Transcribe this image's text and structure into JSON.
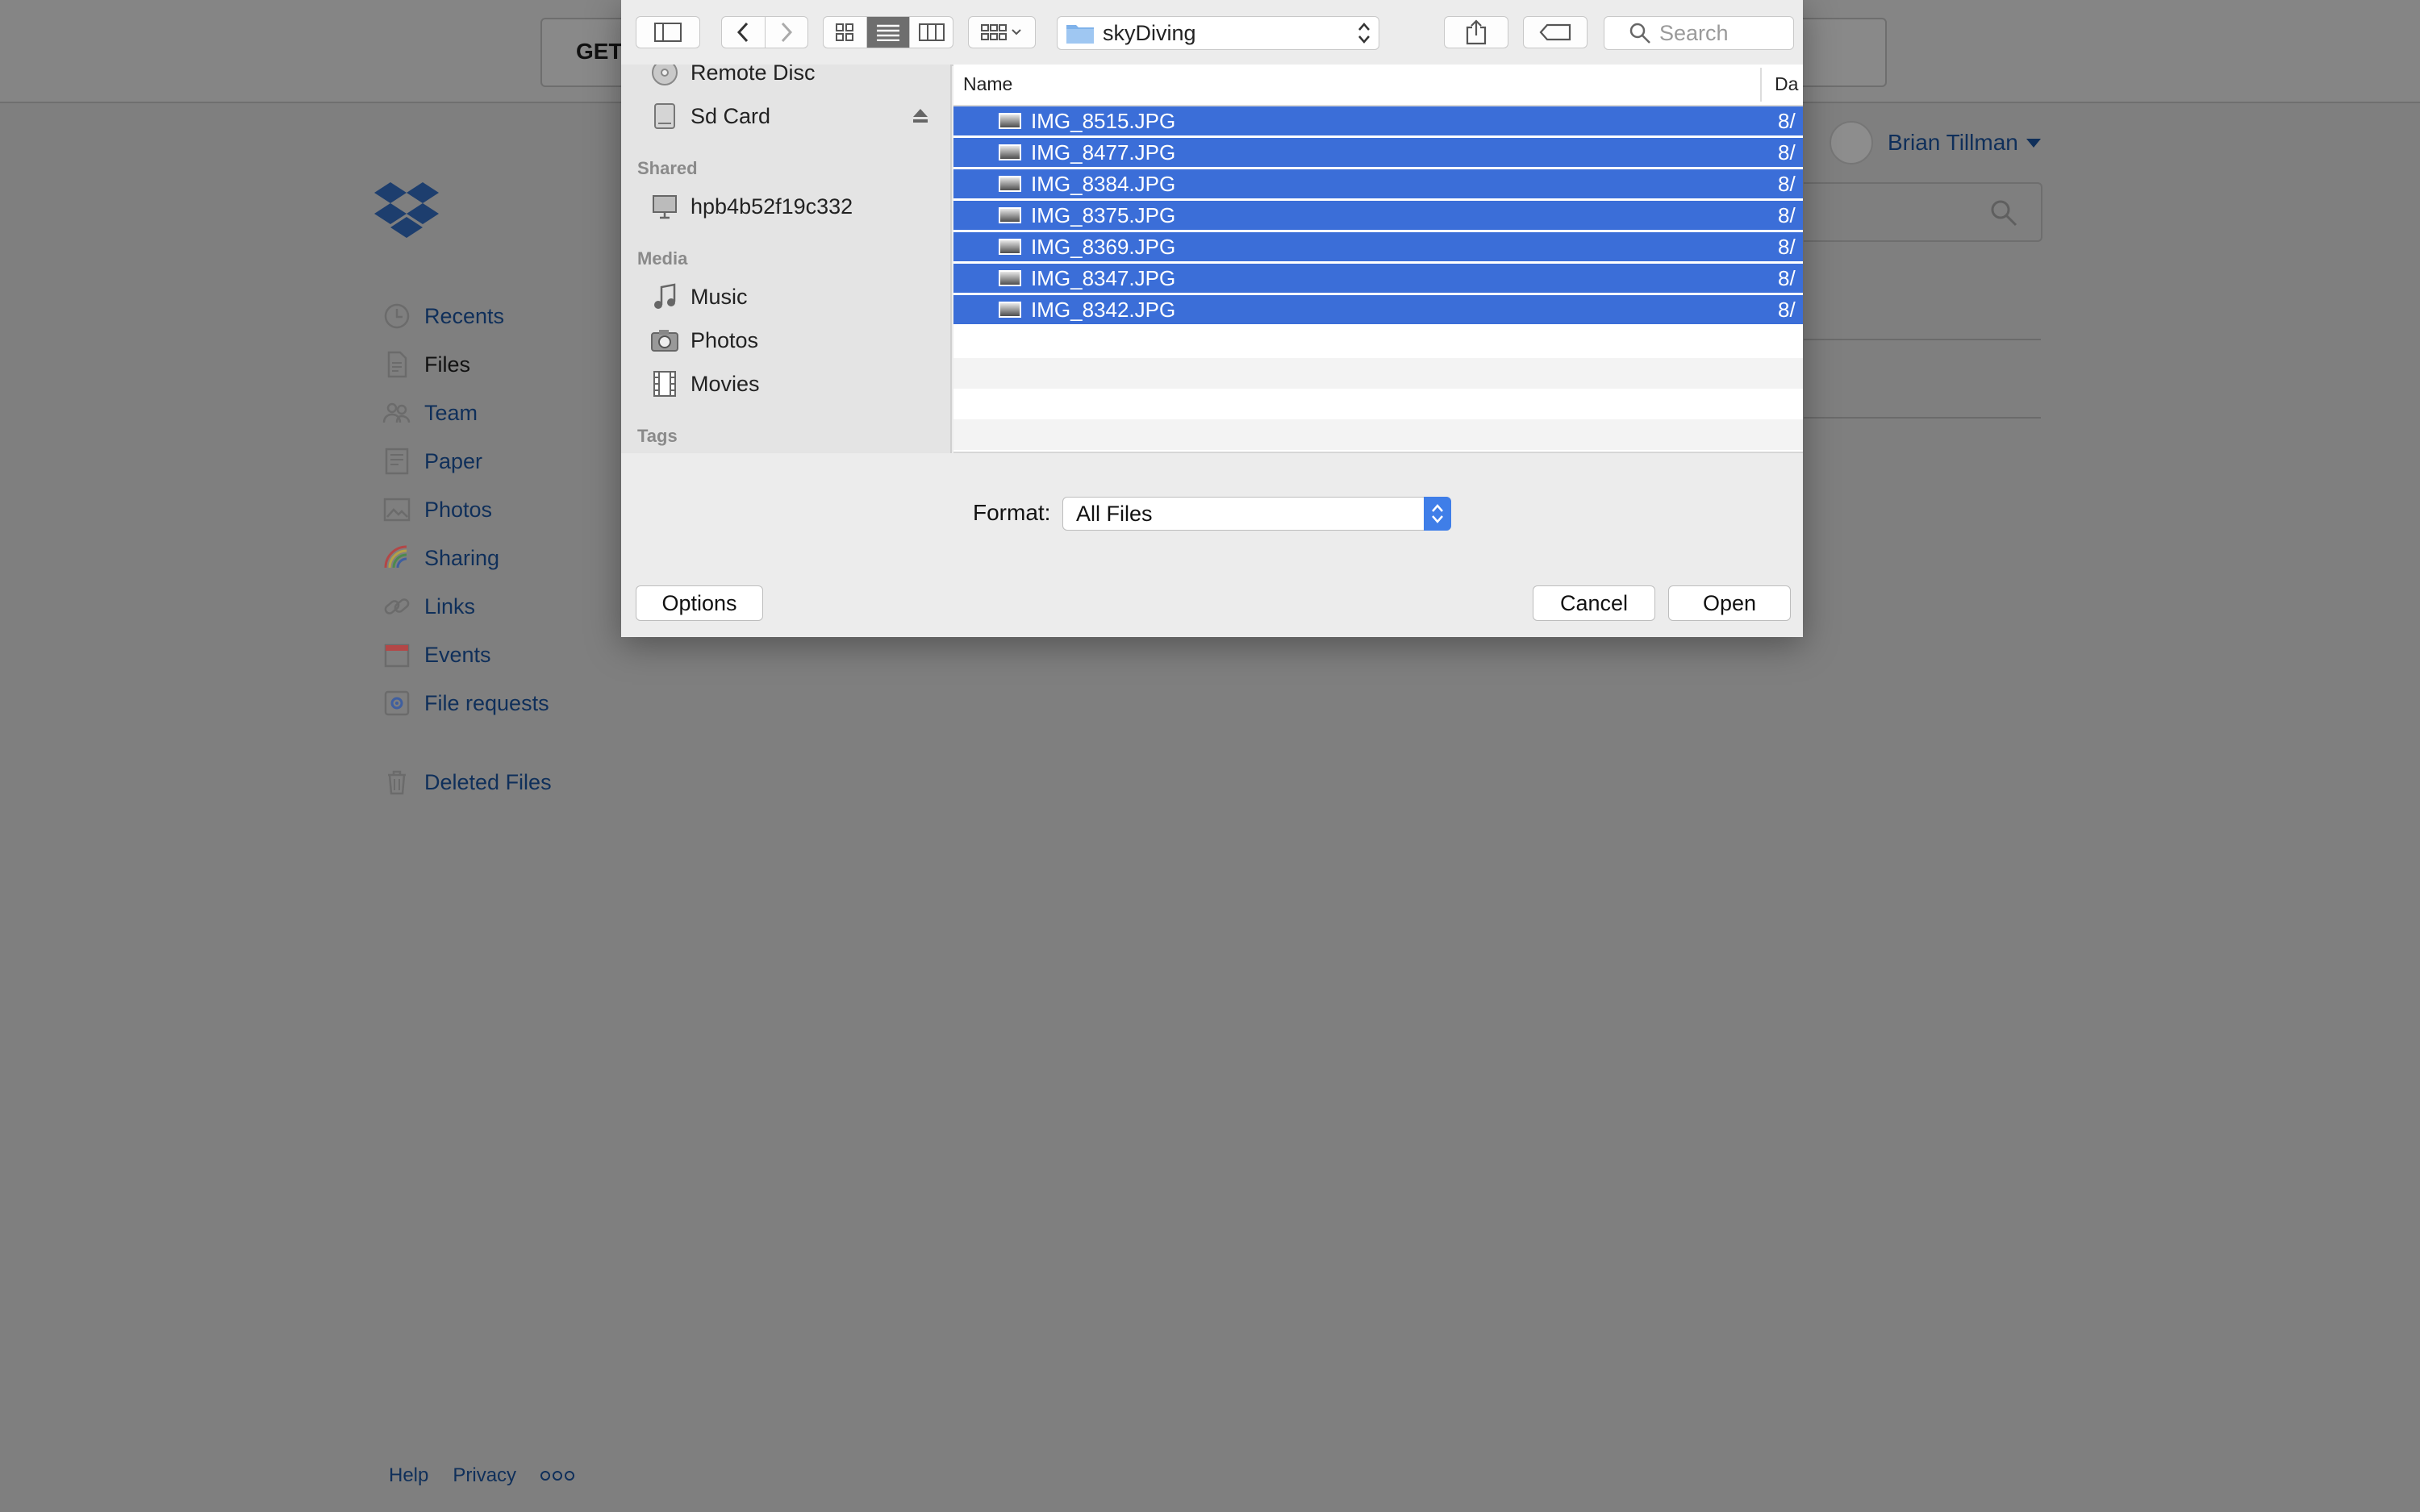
{
  "background": {
    "get_button_label": "GET",
    "user_name": "Brian Tillman",
    "nav": [
      {
        "label": "Recents",
        "icon": "clock-icon"
      },
      {
        "label": "Files",
        "icon": "file-icon"
      },
      {
        "label": "Team",
        "icon": "team-icon"
      },
      {
        "label": "Paper",
        "icon": "paper-icon"
      },
      {
        "label": "Photos",
        "icon": "photos-icon"
      },
      {
        "label": "Sharing",
        "icon": "sharing-icon"
      },
      {
        "label": "Links",
        "icon": "link-icon"
      },
      {
        "label": "Events",
        "icon": "calendar-icon"
      },
      {
        "label": "File requests",
        "icon": "file-request-icon"
      },
      {
        "label": "Deleted Files",
        "icon": "trash-icon"
      }
    ],
    "footer": {
      "help": "Help",
      "privacy": "Privacy"
    }
  },
  "dialog": {
    "current_folder": "skyDiving",
    "search_placeholder": "Search",
    "sidebar": {
      "devices": [
        {
          "label": "Remote Disc",
          "icon": "disc-icon"
        },
        {
          "label": "Sd Card",
          "icon": "drive-icon"
        }
      ],
      "shared_header": "Shared",
      "shared": [
        {
          "label": "hpb4b52f19c332",
          "icon": "computer-icon"
        }
      ],
      "media_header": "Media",
      "media": [
        {
          "label": "Music",
          "icon": "music-icon"
        },
        {
          "label": "Photos",
          "icon": "camera-icon"
        },
        {
          "label": "Movies",
          "icon": "film-icon"
        }
      ],
      "tags_header": "Tags"
    },
    "columns": {
      "name": "Name",
      "date": "Da"
    },
    "files": [
      {
        "name": "IMG_8515.JPG",
        "date": "8/"
      },
      {
        "name": "IMG_8477.JPG",
        "date": "8/"
      },
      {
        "name": "IMG_8384.JPG",
        "date": "8/"
      },
      {
        "name": "IMG_8375.JPG",
        "date": "8/"
      },
      {
        "name": "IMG_8369.JPG",
        "date": "8/"
      },
      {
        "name": "IMG_8347.JPG",
        "date": "8/"
      },
      {
        "name": "IMG_8342.JPG",
        "date": "8/"
      }
    ],
    "format_label": "Format:",
    "format_value": "All Files",
    "options_label": "Options",
    "cancel_label": "Cancel",
    "open_label": "Open"
  },
  "colors": {
    "selection": "#3b6ed8",
    "accent": "#3f7ee8",
    "link": "#0f2f5a"
  }
}
